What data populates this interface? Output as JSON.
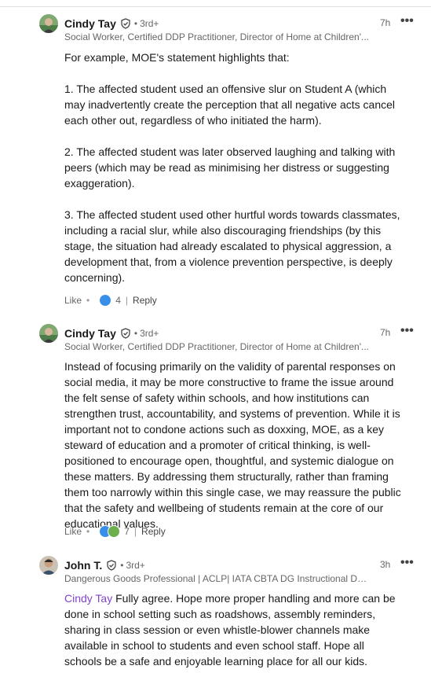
{
  "comments": [
    {
      "author": "Cindy Tay",
      "degree": "3rd+",
      "headline": "Social Worker, Certified DDP Practitioner, Director of Home at Children'...",
      "time": "7h",
      "paragraphs": [
        "For example, MOE's statement highlights that:",
        "1. The affected student used an offensive slur on Student A (which may inadvertently create the perception that all negative acts cancel each other out, regardless of who initiated the harm).",
        "2. The affected student was later observed laughing and talking with peers (which may be read as minimising her distress or suggesting exaggeration).",
        "3. The affected student used other hurtful words towards classmates, including a racial slur, while also discouraging friendships (by this stage, the situation had already escalated to physical aggression, a development that, from a violence prevention perspective, is deeply concerning)."
      ],
      "like_label": "Like",
      "reaction_count": "4",
      "reply_label": "Reply"
    },
    {
      "author": "Cindy Tay",
      "degree": "3rd+",
      "headline": "Social Worker, Certified DDP Practitioner, Director of Home at Children'...",
      "time": "7h",
      "paragraphs": [
        "Instead of focusing primarily on the validity of parental responses on social media, it may be more constructive to frame the issue around the felt sense of safety within schools, and how institutions can strengthen trust, accountability, and systems of prevention. While it is important not to condone actions such as doxxing, MOE, as a key steward of education and a promoter of critical thinking, is well-positioned to encourage open, thoughtful, and systemic dialogue on these matters. By addressing them structurally, rather than framing them too narrowly within this single case, we may reassure the public that the safety and wellbeing of students remain at the core of our educational values."
      ],
      "like_label": "Like",
      "reaction_count": "7",
      "reply_label": "Reply"
    },
    {
      "author": "John T.",
      "degree": "3rd+",
      "headline": "Dangerous Goods Professional | ACLP| IATA CBTA DG Instructional Desi...",
      "time": "3h",
      "mention": "Cindy Tay",
      "paragraphs": [
        " Fully agree. Hope more proper handling and more can be done in school setting such as roadshows, assembly reminders, sharing in class session or even whistle-blower channels make available in school to students and even school staff. Hope all schools be a safe and enjoyable learning place for all our kids."
      ]
    }
  ],
  "more_glyph": "•••",
  "dot": "•",
  "colors": {
    "mention": "#8344cc",
    "like_blue": "#378fe9",
    "celebrate": "#6dae4f",
    "support": "#c37d16"
  },
  "icons": [
    "verified-shield-icon",
    "more-icon",
    "like-reaction-icon",
    "celebrate-reaction-icon"
  ]
}
